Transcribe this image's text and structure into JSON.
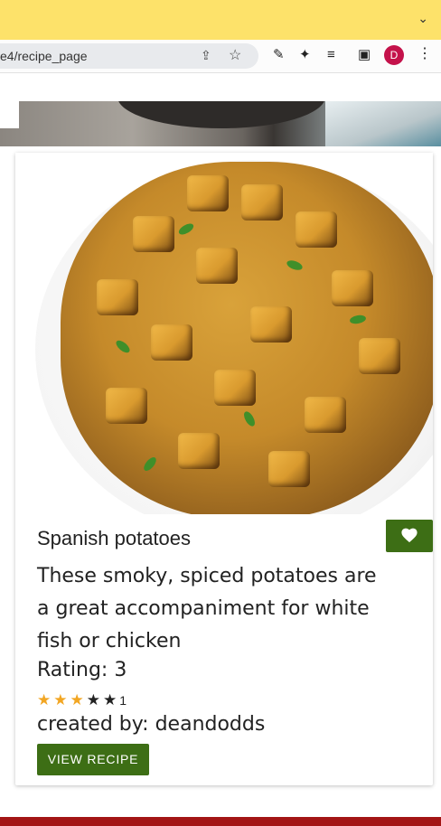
{
  "browser": {
    "url": "e4/recipe_page",
    "avatar_letter": "D",
    "icons": [
      "share-icon",
      "star-icon",
      "eyedropper-icon",
      "extensions-icon",
      "reading-list-icon",
      "sidepanel-icon",
      "kebab-menu-icon"
    ]
  },
  "recipe": {
    "title": "Spanish potatoes",
    "description": "These smoky, spiced potatoes are a great accompaniment for white fish or chicken",
    "rating_text": "Rating: 3",
    "rating_value": 3,
    "rating_max": 5,
    "rating_count": "1",
    "creator_text": "created by: deandodds",
    "view_button_label": "VIEW RECIPE"
  },
  "colors": {
    "accent_green": "#3d6e15",
    "star_filled": "#f2a623",
    "tab_bar": "#fde26a",
    "footer": "#a31515"
  }
}
